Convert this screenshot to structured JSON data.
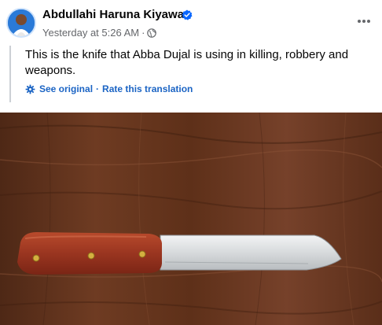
{
  "post": {
    "author": {
      "name": "Abdullahi Haruna Kiyawa",
      "verified": true
    },
    "timestamp": "Yesterday at 5:26 AM",
    "separator_dot": "·",
    "privacy_icon": "globe-icon",
    "more_icon": "more-horizontal-icon",
    "text": "This is the knife that Abba Dujal is using in killing, robbery and weapons.",
    "translation": {
      "icon": "gear-icon",
      "see_original": "See original",
      "separator": "·",
      "rate": "Rate this translation"
    },
    "photo": {
      "subject": "knife-on-wooden-table"
    }
  },
  "colors": {
    "name": "#050505",
    "meta": "#65676b",
    "link": "#1b64c4",
    "verified": "#0866ff",
    "wood": "#6b3a22",
    "handle": "#9a3520",
    "blade": "#d9dcde"
  }
}
